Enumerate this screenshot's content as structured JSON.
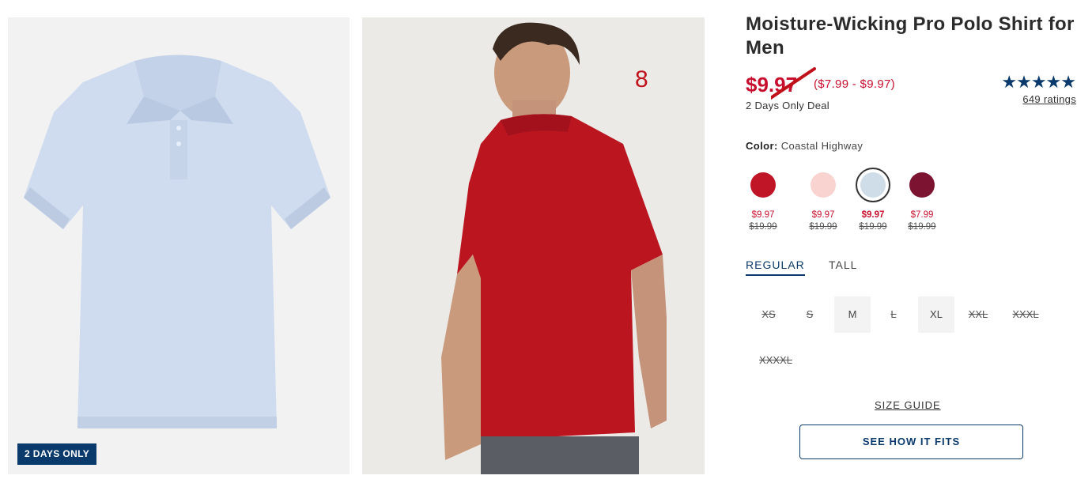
{
  "images": {
    "badge": "2 DAYS ONLY",
    "annotation_number": "8"
  },
  "product": {
    "title": "Moisture-Wicking Pro Polo Shirt for Men",
    "price": "$9.97",
    "price_range": "($7.99 - $9.97)",
    "deal": "2 Days Only Deal",
    "stars": "★★★★★",
    "rating_value": 5,
    "ratings_count": "649 ratings"
  },
  "color": {
    "label": "Color:",
    "selected": "Coastal Highway",
    "swatches": [
      {
        "color": "#c01526",
        "sale": "$9.97",
        "orig": "$19.99",
        "selected": false
      },
      {
        "color": "#f8d3d0",
        "sale": "$9.97",
        "orig": "$19.99",
        "selected": false
      },
      {
        "color": "#cfdde8",
        "sale": "$9.97",
        "orig": "$19.99",
        "selected": true
      },
      {
        "color": "#7c1431",
        "sale": "$7.99",
        "orig": "$19.99",
        "selected": false
      }
    ]
  },
  "fit": {
    "tabs": [
      "REGULAR",
      "TALL"
    ]
  },
  "sizes": [
    "XS",
    "S",
    "M",
    "L",
    "XL",
    "XXL",
    "XXXL",
    "XXXXL"
  ],
  "actions": {
    "size_guide": "SIZE GUIDE",
    "see_how_it_fits": "SEE HOW IT FITS"
  },
  "colors": {
    "brand_navy": "#0a3a6b",
    "sale_red": "#c8102e"
  }
}
